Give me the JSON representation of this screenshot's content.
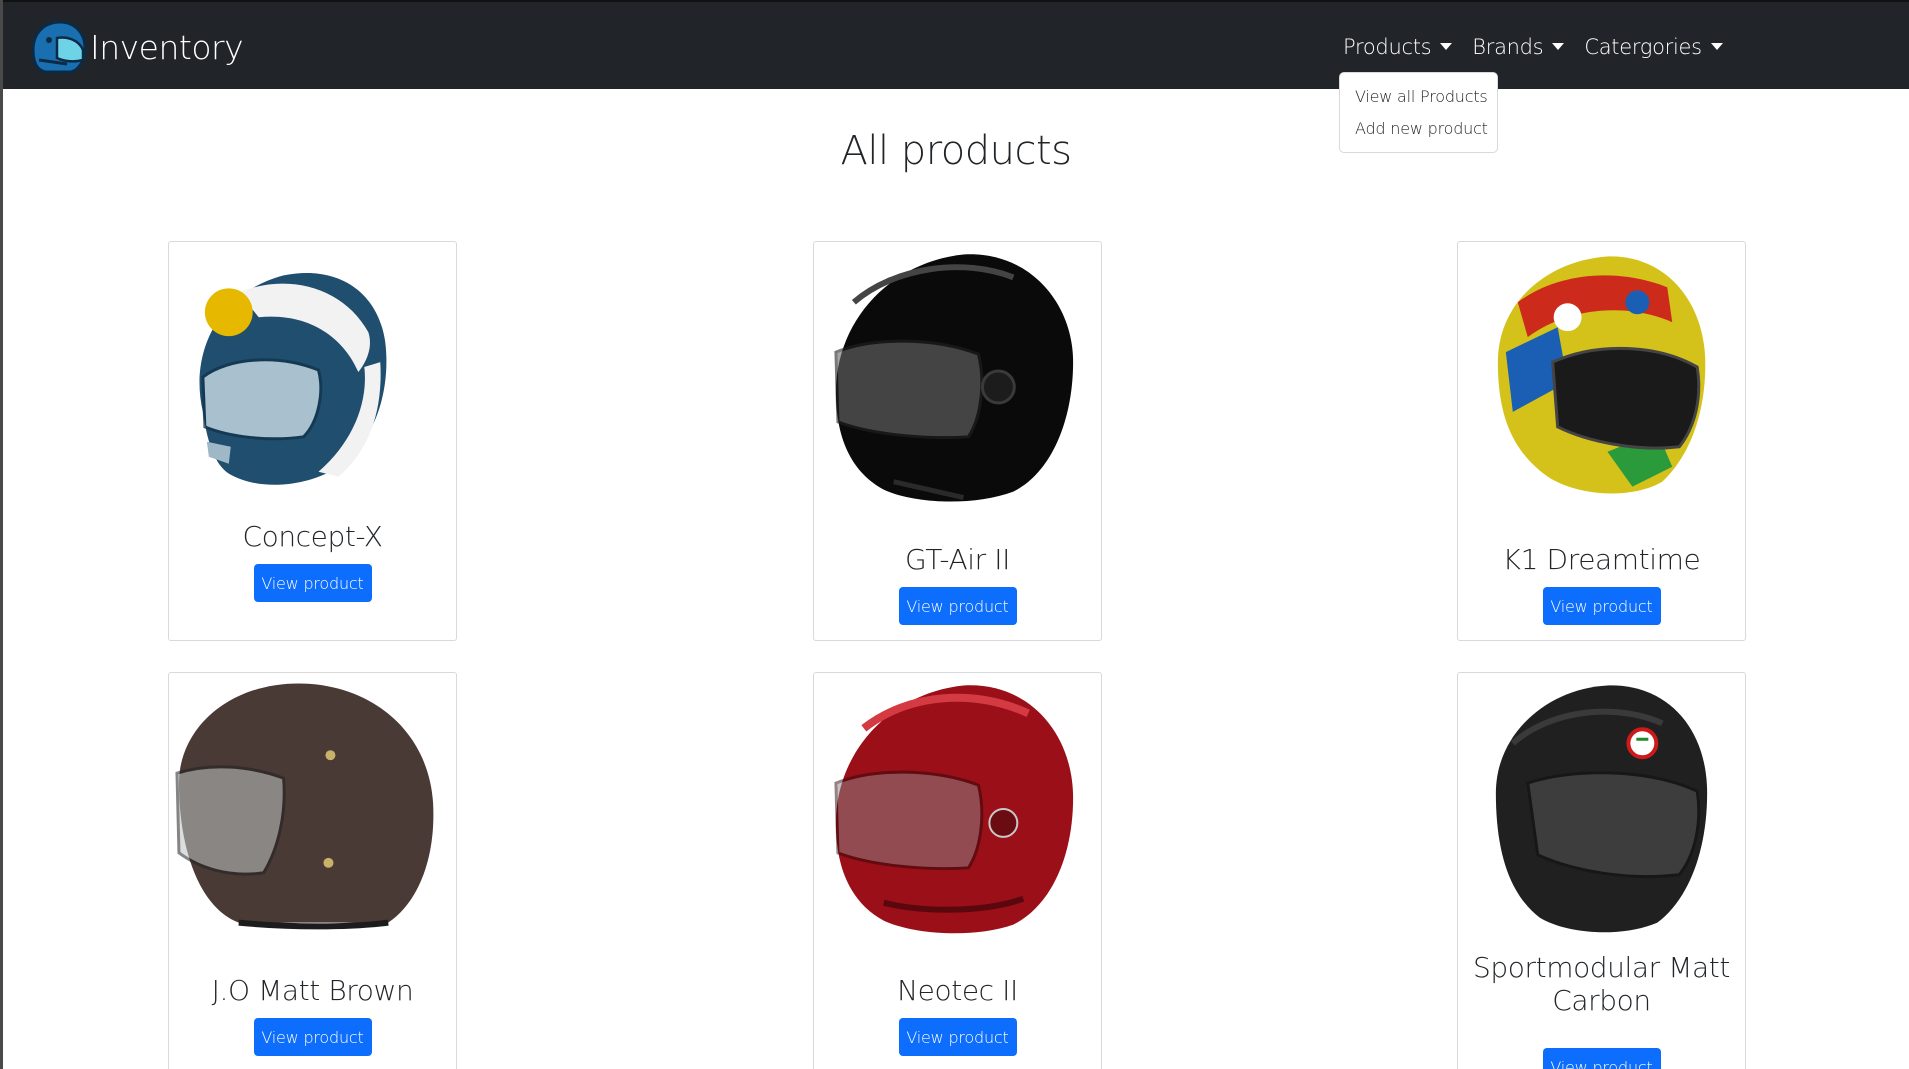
{
  "brand": {
    "name": "Inventory",
    "logo_icon": "helmet-logo-icon"
  },
  "nav": {
    "items": [
      {
        "label": "Products"
      },
      {
        "label": "Brands"
      },
      {
        "label": "Catergories"
      }
    ]
  },
  "dropdown": {
    "items": [
      {
        "label": "View all Products"
      },
      {
        "label": "Add new product"
      }
    ]
  },
  "page": {
    "title": "All products"
  },
  "products": [
    {
      "name": "Concept-X",
      "button": "View product",
      "helmet_color": "#1f4e6e"
    },
    {
      "name": "GT-Air II",
      "button": "View product",
      "helmet_color": "#0a0a0a"
    },
    {
      "name": "K1 Dreamtime",
      "button": "View product",
      "helmet_color": "#d4c21a"
    },
    {
      "name": "J.O Matt Brown",
      "button": "View product",
      "helmet_color": "#4a3a36"
    },
    {
      "name": "Neotec II",
      "button": "View product",
      "helmet_color": "#9b0f18"
    },
    {
      "name": "Sportmodular Matt Carbon",
      "button": "View product",
      "helmet_color": "#202020"
    }
  ],
  "colors": {
    "navbar": "#212529",
    "primary": "#0d6efd"
  }
}
